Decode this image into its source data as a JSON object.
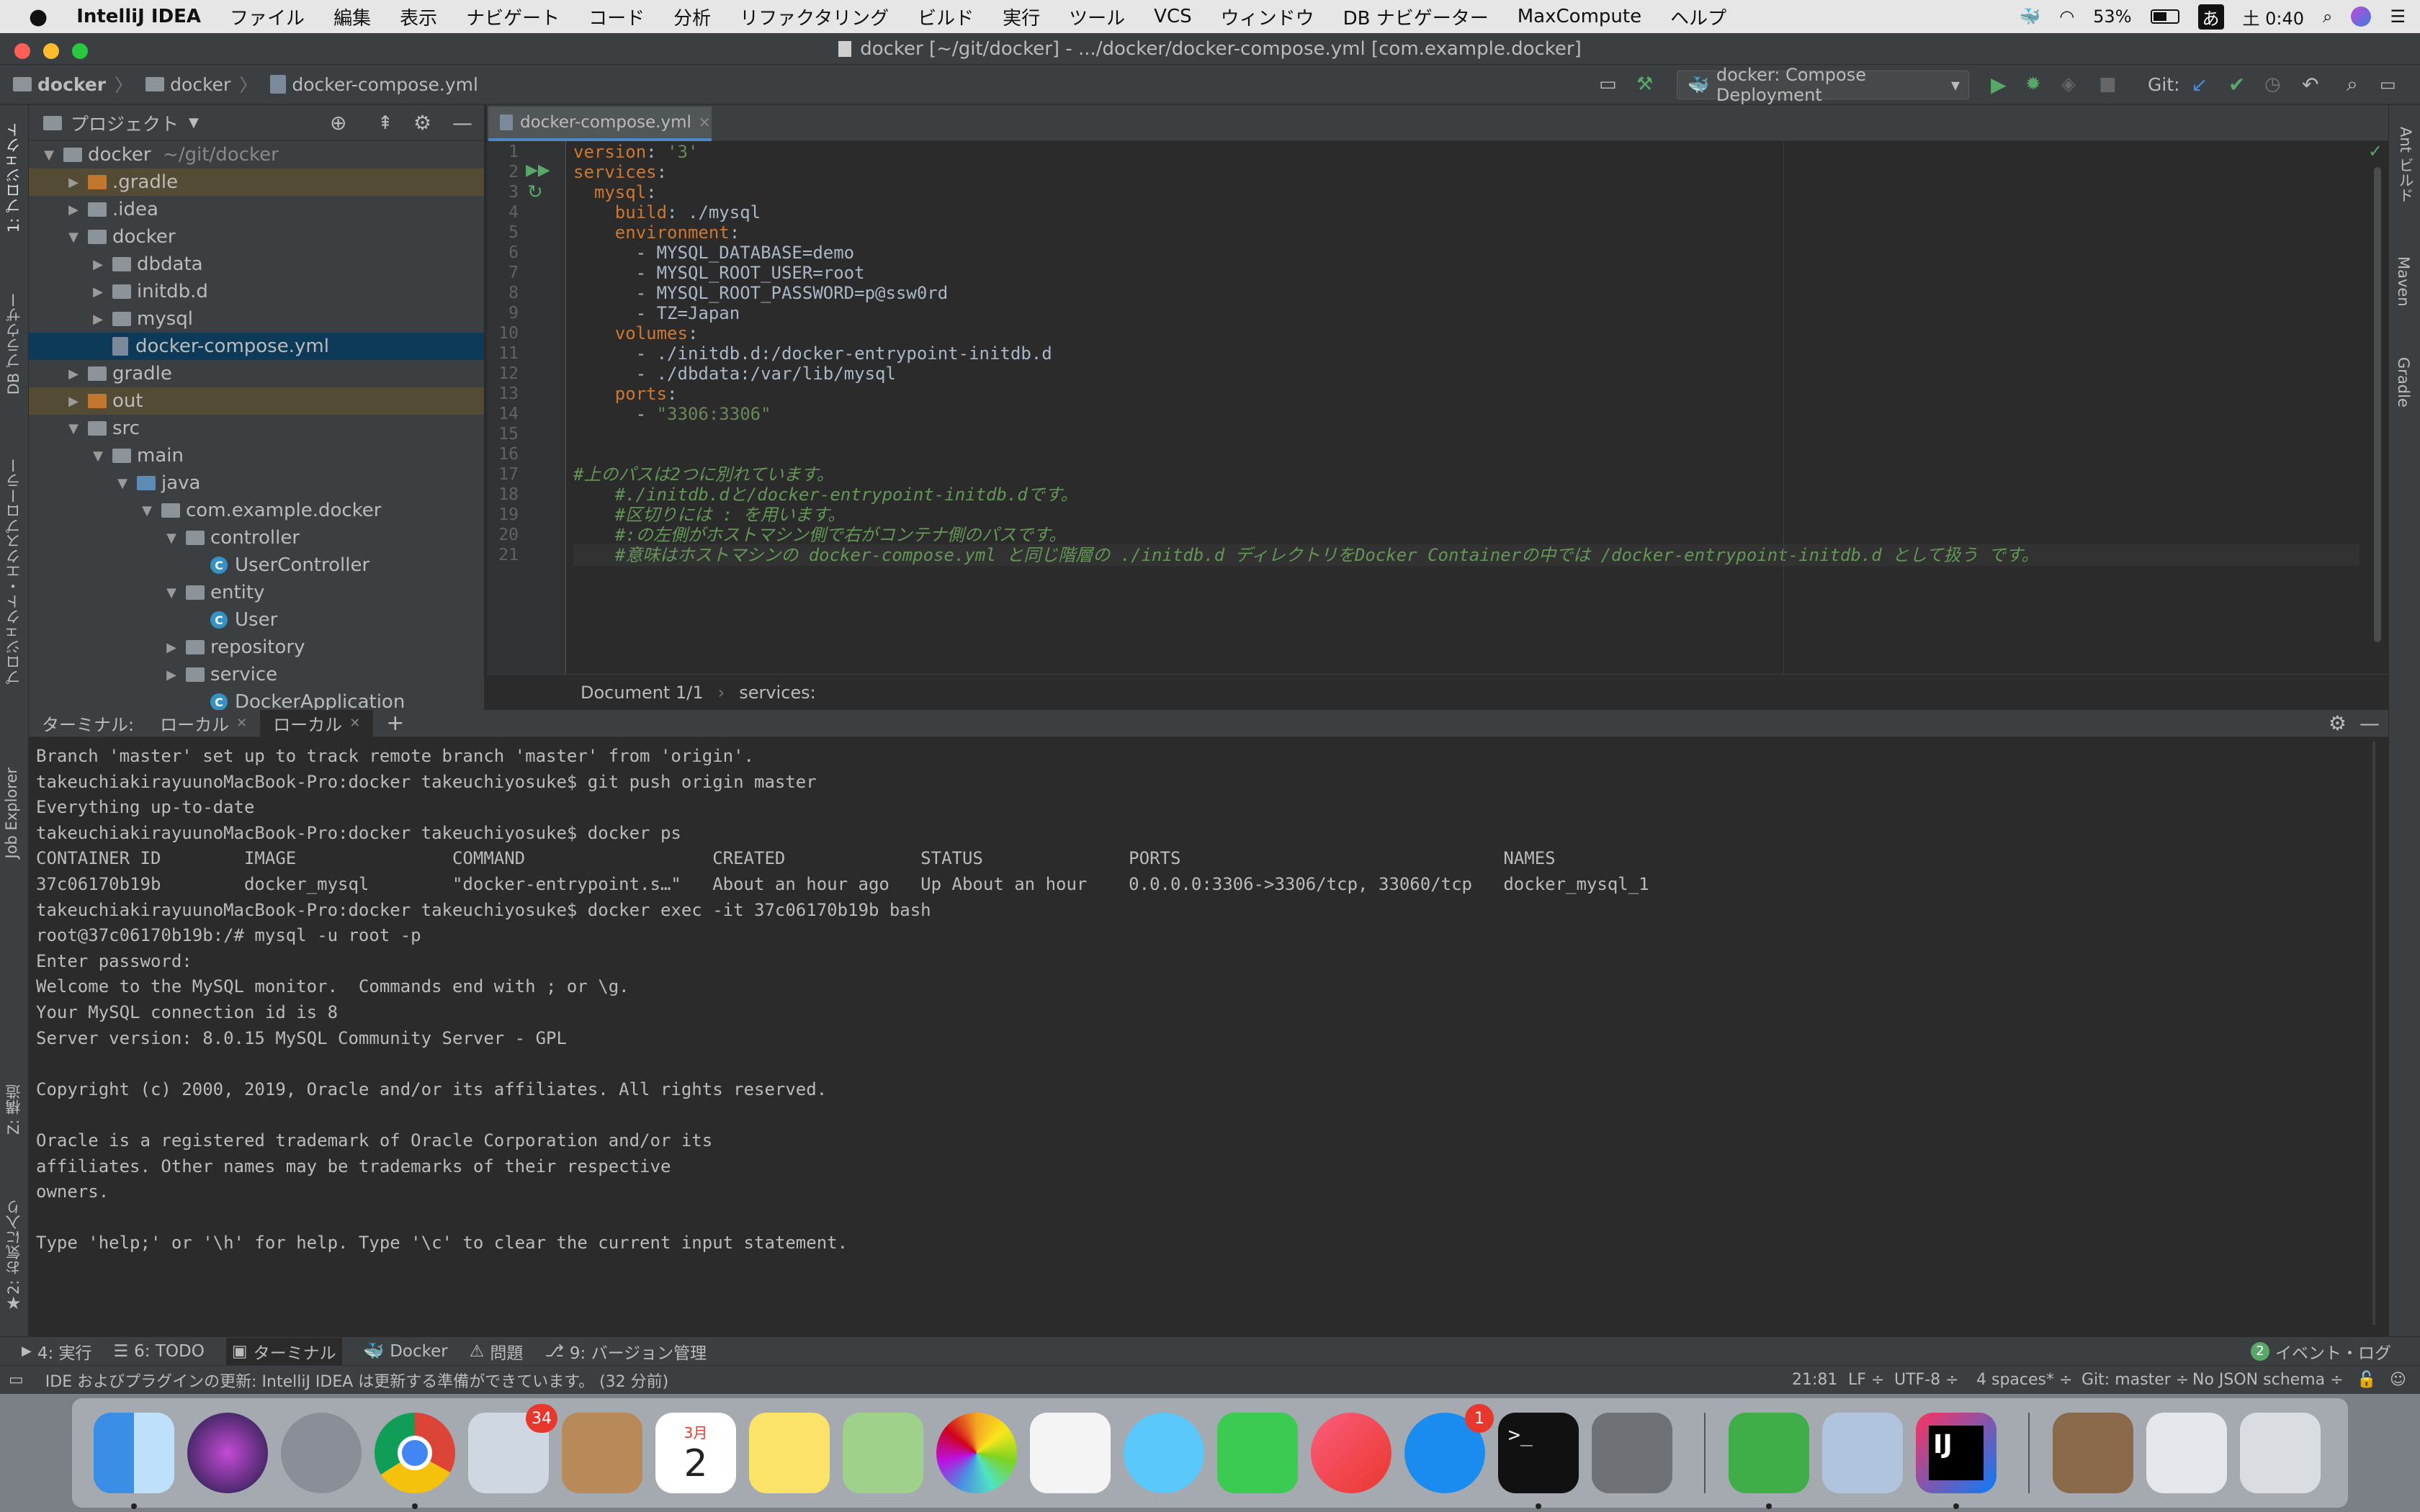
{
  "menubar": {
    "app": "IntelliJ IDEA",
    "items": [
      "ファイル",
      "編集",
      "表示",
      "ナビゲート",
      "コード",
      "分析",
      "リファクタリング",
      "ビルド",
      "実行",
      "ツール",
      "VCS",
      "ウィンドウ",
      "DB ナビゲーター",
      "MaxCompute",
      "ヘルプ"
    ],
    "battery": "53%",
    "ime": "あ",
    "clock": "土 0:40"
  },
  "window": {
    "title": "docker [~/git/docker] - .../docker/docker-compose.yml [com.example.docker]"
  },
  "navbar": {
    "crumbs": [
      "docker",
      "docker",
      "docker-compose.yml"
    ],
    "run_config": "docker: Compose Deployment",
    "git_label": "Git:"
  },
  "left_stripe": {
    "project": "1: プロジェクト",
    "db": "DB ブラウザー",
    "explorer": "プロジェクト・エクスプローラー",
    "job": "Job Explorer",
    "structure": "Z: 構造",
    "favorites": "2: お気に入り"
  },
  "right_stripe": {
    "ant": "Ant ビルド",
    "maven": "Maven",
    "gradle": "Gradle"
  },
  "project": {
    "header": "プロジェクト",
    "tree": [
      {
        "label": "docker",
        "suffix": "~/git/docker",
        "indent": 0,
        "arrow": "▼",
        "icon": "folder"
      },
      {
        "label": ".gradle",
        "indent": 1,
        "arrow": "▶",
        "icon": "folder-orange",
        "highlight": "orange"
      },
      {
        "label": ".idea",
        "indent": 1,
        "arrow": "▶",
        "icon": "folder"
      },
      {
        "label": "docker",
        "indent": 1,
        "arrow": "▼",
        "icon": "folder"
      },
      {
        "label": "dbdata",
        "indent": 2,
        "arrow": "▶",
        "icon": "folder"
      },
      {
        "label": "initdb.d",
        "indent": 2,
        "arrow": "▶",
        "icon": "folder"
      },
      {
        "label": "mysql",
        "indent": 2,
        "arrow": "▶",
        "icon": "folder"
      },
      {
        "label": "docker-compose.yml",
        "indent": 2,
        "arrow": "",
        "icon": "yml",
        "highlight": "selected"
      },
      {
        "label": "gradle",
        "indent": 1,
        "arrow": "▶",
        "icon": "folder"
      },
      {
        "label": "out",
        "indent": 1,
        "arrow": "▶",
        "icon": "folder-orange",
        "highlight": "orange"
      },
      {
        "label": "src",
        "indent": 1,
        "arrow": "▼",
        "icon": "folder"
      },
      {
        "label": "main",
        "indent": 2,
        "arrow": "▼",
        "icon": "folder"
      },
      {
        "label": "java",
        "indent": 3,
        "arrow": "▼",
        "icon": "folder-blue"
      },
      {
        "label": "com.example.docker",
        "indent": 4,
        "arrow": "▼",
        "icon": "folder"
      },
      {
        "label": "controller",
        "indent": 5,
        "arrow": "▼",
        "icon": "folder"
      },
      {
        "label": "UserController",
        "indent": 6,
        "arrow": "",
        "icon": "class"
      },
      {
        "label": "entity",
        "indent": 5,
        "arrow": "▼",
        "icon": "folder"
      },
      {
        "label": "User",
        "indent": 6,
        "arrow": "",
        "icon": "class"
      },
      {
        "label": "repository",
        "indent": 5,
        "arrow": "▶",
        "icon": "folder"
      },
      {
        "label": "service",
        "indent": 5,
        "arrow": "▶",
        "icon": "folder"
      },
      {
        "label": "DockerApplication",
        "indent": 6,
        "arrow": "",
        "icon": "class"
      }
    ]
  },
  "editor": {
    "tab": "docker-compose.yml",
    "lines": [
      [
        [
          "k",
          "version"
        ],
        [
          "v",
          ": "
        ],
        [
          "s",
          "'3'"
        ]
      ],
      [
        [
          "k",
          "services"
        ],
        [
          "v",
          ":"
        ]
      ],
      [
        [
          "v",
          "  "
        ],
        [
          "k",
          "mysql"
        ],
        [
          "v",
          ":"
        ]
      ],
      [
        [
          "v",
          "    "
        ],
        [
          "k",
          "build"
        ],
        [
          "v",
          ": ./mysql"
        ]
      ],
      [
        [
          "v",
          "    "
        ],
        [
          "k",
          "environment"
        ],
        [
          "v",
          ":"
        ]
      ],
      [
        [
          "v",
          "      - MYSQL_DATABASE=demo"
        ]
      ],
      [
        [
          "v",
          "      - MYSQL_ROOT_USER=root"
        ]
      ],
      [
        [
          "v",
          "      - MYSQL_ROOT_PASSWORD=p@ssw0rd"
        ]
      ],
      [
        [
          "v",
          "      - TZ=Japan"
        ]
      ],
      [
        [
          "v",
          "    "
        ],
        [
          "k",
          "volumes"
        ],
        [
          "v",
          ":"
        ]
      ],
      [
        [
          "v",
          "      - ./initdb.d:/docker-entrypoint-initdb.d"
        ]
      ],
      [
        [
          "v",
          "      - ./dbdata:/var/lib/mysql"
        ]
      ],
      [
        [
          "v",
          "    "
        ],
        [
          "k",
          "ports"
        ],
        [
          "v",
          ":"
        ]
      ],
      [
        [
          "v",
          "      - "
        ],
        [
          "s",
          "\"3306:3306\""
        ]
      ],
      [
        [
          "v",
          ""
        ]
      ],
      [
        [
          "v",
          ""
        ]
      ],
      [
        [
          "c",
          "#上のパスは2つに別れています。"
        ]
      ],
      [
        [
          "c",
          "    #./initdb.dと/docker-entrypoint-initdb.dです。"
        ]
      ],
      [
        [
          "c",
          "    #区切りには : を用います。"
        ]
      ],
      [
        [
          "c",
          "    #:の左側がホストマシン側で右がコンテナ側のパスです。"
        ]
      ],
      [
        [
          "c",
          "    #意味はホストマシンの docker-compose.yml と同じ階層の ./initdb.d ディレクトリをDocker Containerの中では /docker-entrypoint-initdb.d として扱う です。"
        ]
      ]
    ],
    "footer": {
      "doc": "Document 1/1",
      "path": "services:"
    }
  },
  "terminal": {
    "label": "ターミナル:",
    "tabs": [
      "ローカル",
      "ローカル"
    ],
    "lines": [
      "Branch 'master' set up to track remote branch 'master' from 'origin'.",
      "takeuchiakirayuunoMacBook-Pro:docker takeuchiyosuke$ git push origin master",
      "Everything up-to-date",
      "takeuchiakirayuunoMacBook-Pro:docker takeuchiyosuke$ docker ps",
      "CONTAINER ID        IMAGE               COMMAND                  CREATED             STATUS              PORTS                               NAMES",
      "37c06170b19b        docker_mysql        \"docker-entrypoint.s…\"   About an hour ago   Up About an hour    0.0.0.0:3306->3306/tcp, 33060/tcp   docker_mysql_1",
      "takeuchiakirayuunoMacBook-Pro:docker takeuchiyosuke$ docker exec -it 37c06170b19b bash",
      "root@37c06170b19b:/# mysql -u root -p",
      "Enter password:",
      "Welcome to the MySQL monitor.  Commands end with ; or \\g.",
      "Your MySQL connection id is 8",
      "Server version: 8.0.15 MySQL Community Server - GPL",
      "",
      "Copyright (c) 2000, 2019, Oracle and/or its affiliates. All rights reserved.",
      "",
      "Oracle is a registered trademark of Oracle Corporation and/or its",
      "affiliates. Other names may be trademarks of their respective",
      "owners.",
      "",
      "Type 'help;' or '\\h' for help. Type '\\c' to clear the current input statement."
    ]
  },
  "toolwindows": {
    "run": "4: 実行",
    "todo": "6: TODO",
    "terminal": "ターミナル",
    "docker": "Docker",
    "problems": "問題",
    "vcs": "9: バージョン管理",
    "event_count": "2",
    "event_log": "イベント・ログ"
  },
  "status": {
    "message": "IDE およびプラグインの更新: IntelliJ IDEA は更新する準備ができています。 (32 分前)",
    "position": "21:81",
    "line_sep": "LF ÷",
    "encoding": "UTF-8 ÷",
    "indent": "4 spaces* ÷",
    "git": "Git: master ÷",
    "schema": "No JSON schema ÷"
  },
  "dock": {
    "mail_badge": "34",
    "appstore_badge": "1",
    "calendar_month": "3月",
    "calendar_day": "2"
  }
}
